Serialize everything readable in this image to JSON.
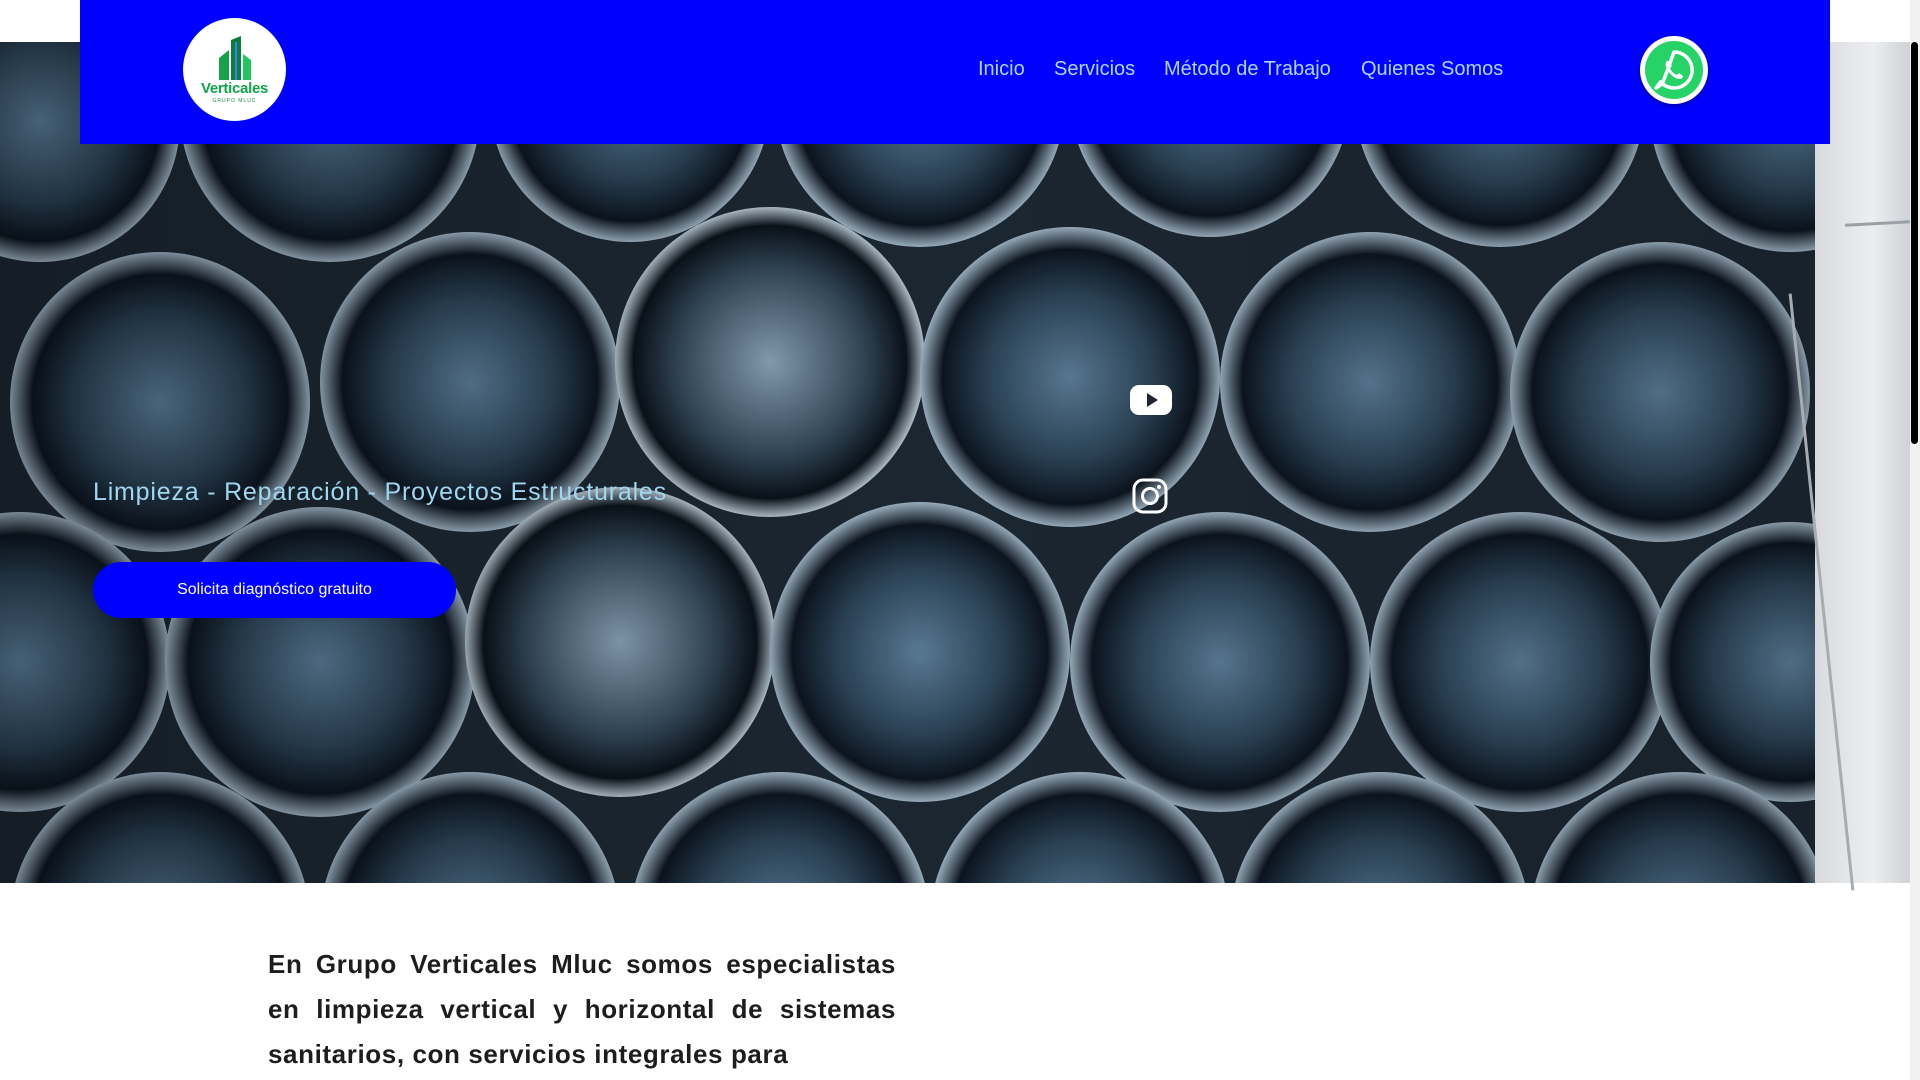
{
  "header": {
    "logo": {
      "word": "Verticales",
      "sub": "GRUPO MLUC",
      "icon": "building-logo-icon"
    },
    "nav": [
      {
        "label": "Inicio"
      },
      {
        "label": "Servicios"
      },
      {
        "label": "Método de Trabajo"
      },
      {
        "label": "Quienes Somos"
      }
    ],
    "whatsapp_icon": "whatsapp-icon"
  },
  "hero": {
    "tagline": "Limpieza - Reparación - Proyectos Estructurales",
    "cta_label": "Solicita diagnóstico gratuito",
    "social": [
      "youtube-icon",
      "instagram-icon"
    ]
  },
  "intro": {
    "text": "En Grupo Verticales Mluc somos especialistas en limpieza vertical y horizontal de sistemas sanitarios, con servicios integrales para"
  },
  "colors": {
    "header_bg": "#0000ff",
    "nav_text": "#a9d8ff",
    "tagline": "#9fd6f0",
    "cta_bg": "#0000ff",
    "whatsapp_green": "#25d366",
    "logo_green": "#12a34d"
  }
}
